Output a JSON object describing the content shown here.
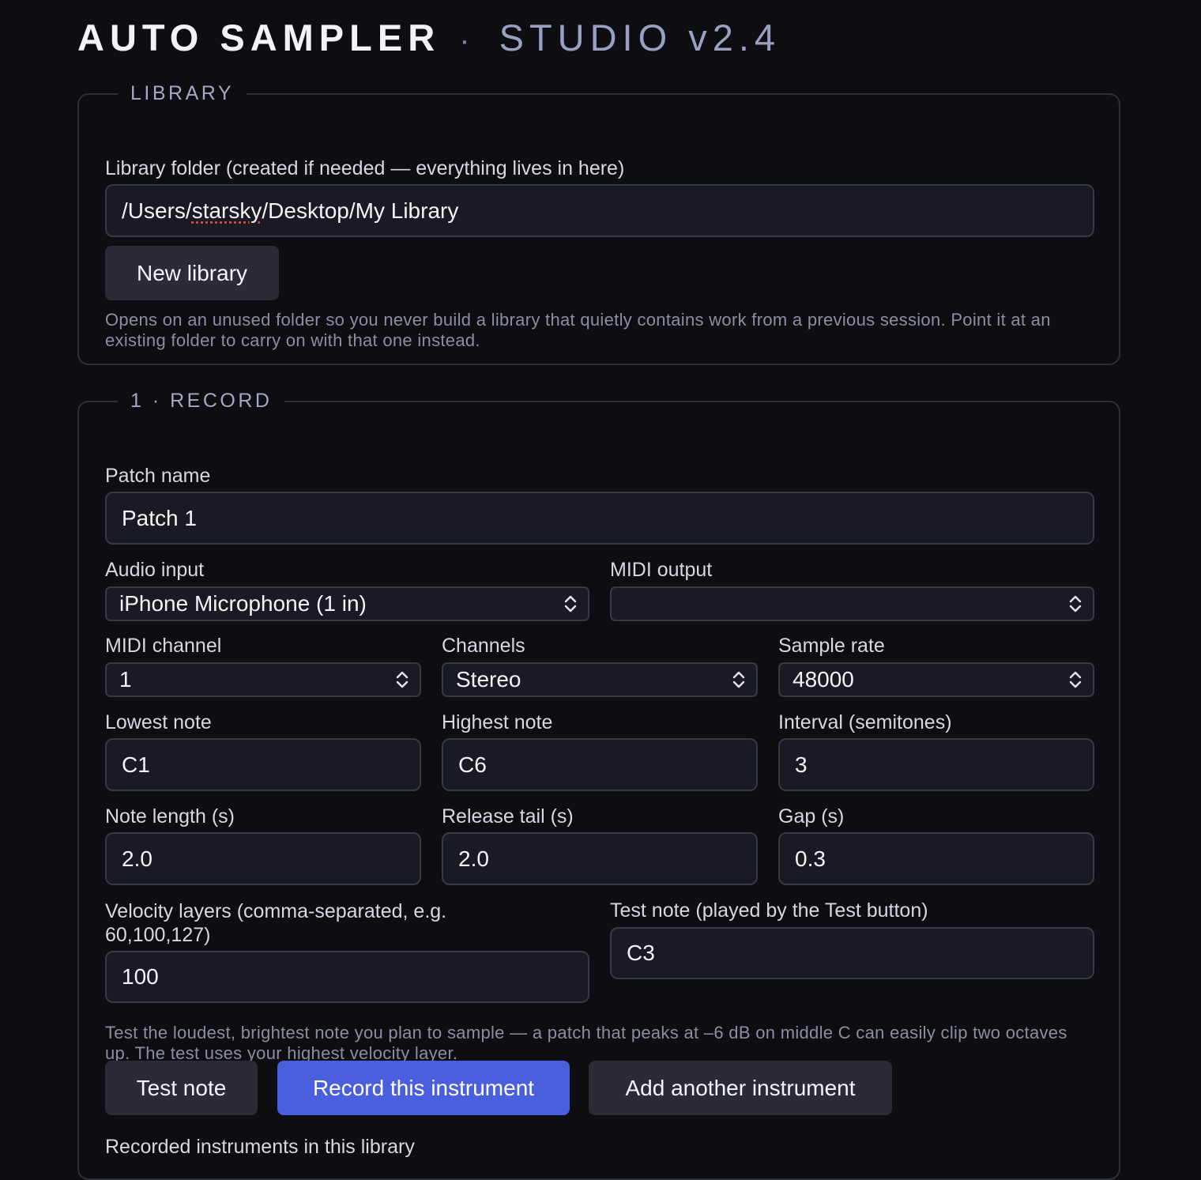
{
  "header": {
    "title": "AUTO SAMPLER",
    "separator": "·",
    "subtitle": "STUDIO v2.4"
  },
  "library": {
    "legend": "LIBRARY",
    "folder_label": "Library folder (created if needed — everything lives in here)",
    "folder_path_prefix": "/Users/",
    "folder_path_user": "starsky",
    "folder_path_suffix": "/Desktop/My Library",
    "new_library_label": "New library",
    "hint": "Opens on an unused folder so you never build a library that quietly contains work from a previous session. Point it at an existing folder to carry on with that one instead."
  },
  "record": {
    "legend": "1 · RECORD",
    "patch_name_label": "Patch name",
    "patch_name_value": "Patch 1",
    "audio_input_label": "Audio input",
    "audio_input_value": "iPhone Microphone (1 in)",
    "midi_output_label": "MIDI output",
    "midi_output_value": "",
    "midi_channel_label": "MIDI channel",
    "midi_channel_value": "1",
    "channels_label": "Channels",
    "channels_value": "Stereo",
    "sample_rate_label": "Sample rate",
    "sample_rate_value": "48000",
    "lowest_note_label": "Lowest note",
    "lowest_note_value": "C1",
    "highest_note_label": "Highest note",
    "highest_note_value": "C6",
    "interval_label": "Interval (semitones)",
    "interval_value": "3",
    "note_length_label": "Note length (s)",
    "note_length_value": "2.0",
    "release_tail_label": "Release tail (s)",
    "release_tail_value": "2.0",
    "gap_label": "Gap (s)",
    "gap_value": "0.3",
    "velocity_label": "Velocity layers (comma-separated, e.g. 60,100,127)",
    "velocity_value": "100",
    "test_note_label": "Test note (played by the Test button)",
    "test_note_value": "C3",
    "test_hint": "Test the loudest, brightest note you plan to sample — a patch that peaks at –6 dB on middle C can easily clip two octaves up. The test uses your highest velocity layer.",
    "test_button": "Test note",
    "record_button": "Record this instrument",
    "add_button": "Add another instrument",
    "recorded_heading": "Recorded instruments in this library"
  },
  "colors": {
    "background": "#0e0e12",
    "accent": "#4a5fde",
    "field_bg": "#1a1b22"
  }
}
